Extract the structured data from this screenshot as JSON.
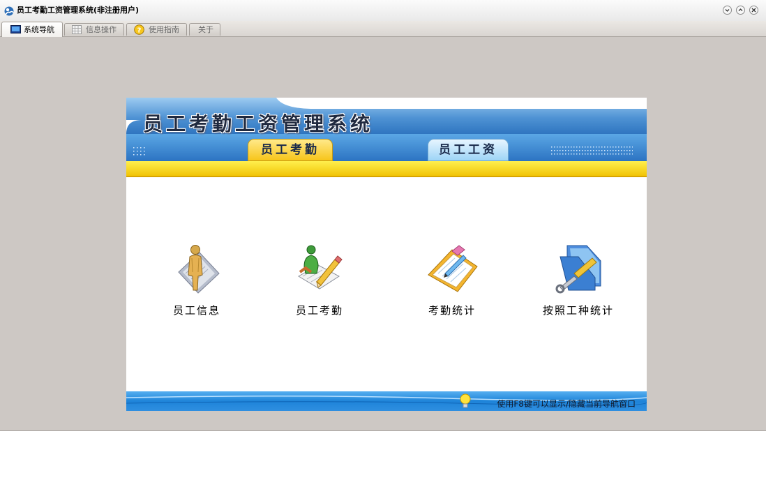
{
  "window": {
    "title": "员工考勤工资管理系统(非注册用户)",
    "controls": [
      "minimize-icon",
      "maximize-icon",
      "close-icon"
    ]
  },
  "tabs": [
    {
      "label": "系统导航",
      "icon": "monitor-icon",
      "active": true
    },
    {
      "label": "信息操作",
      "icon": "grid-icon",
      "active": false
    },
    {
      "label": "使用指南",
      "icon": "help-icon",
      "active": false
    },
    {
      "label": "关于",
      "icon": "",
      "active": false
    }
  ],
  "panel": {
    "title": "员工考勤工资管理系统",
    "nav_tabs": [
      {
        "label": "员工考勤",
        "active": true
      },
      {
        "label": "员工工资",
        "active": false
      }
    ],
    "menu": [
      {
        "label": "员工信息",
        "icon": "employee-info-icon"
      },
      {
        "label": "员工考勤",
        "icon": "employee-attendance-icon"
      },
      {
        "label": "考勤统计",
        "icon": "attendance-stats-icon"
      },
      {
        "label": "按照工种统计",
        "icon": "worktype-stats-icon"
      }
    ],
    "hint": "使用F8键可以显示/隐藏当前导航窗口"
  },
  "colors": {
    "window_bg": "#cdc8c4",
    "banner_blue": "#4e8fce",
    "accent_yellow": "#f3c90d",
    "footer_blue": "#1e84d9"
  }
}
